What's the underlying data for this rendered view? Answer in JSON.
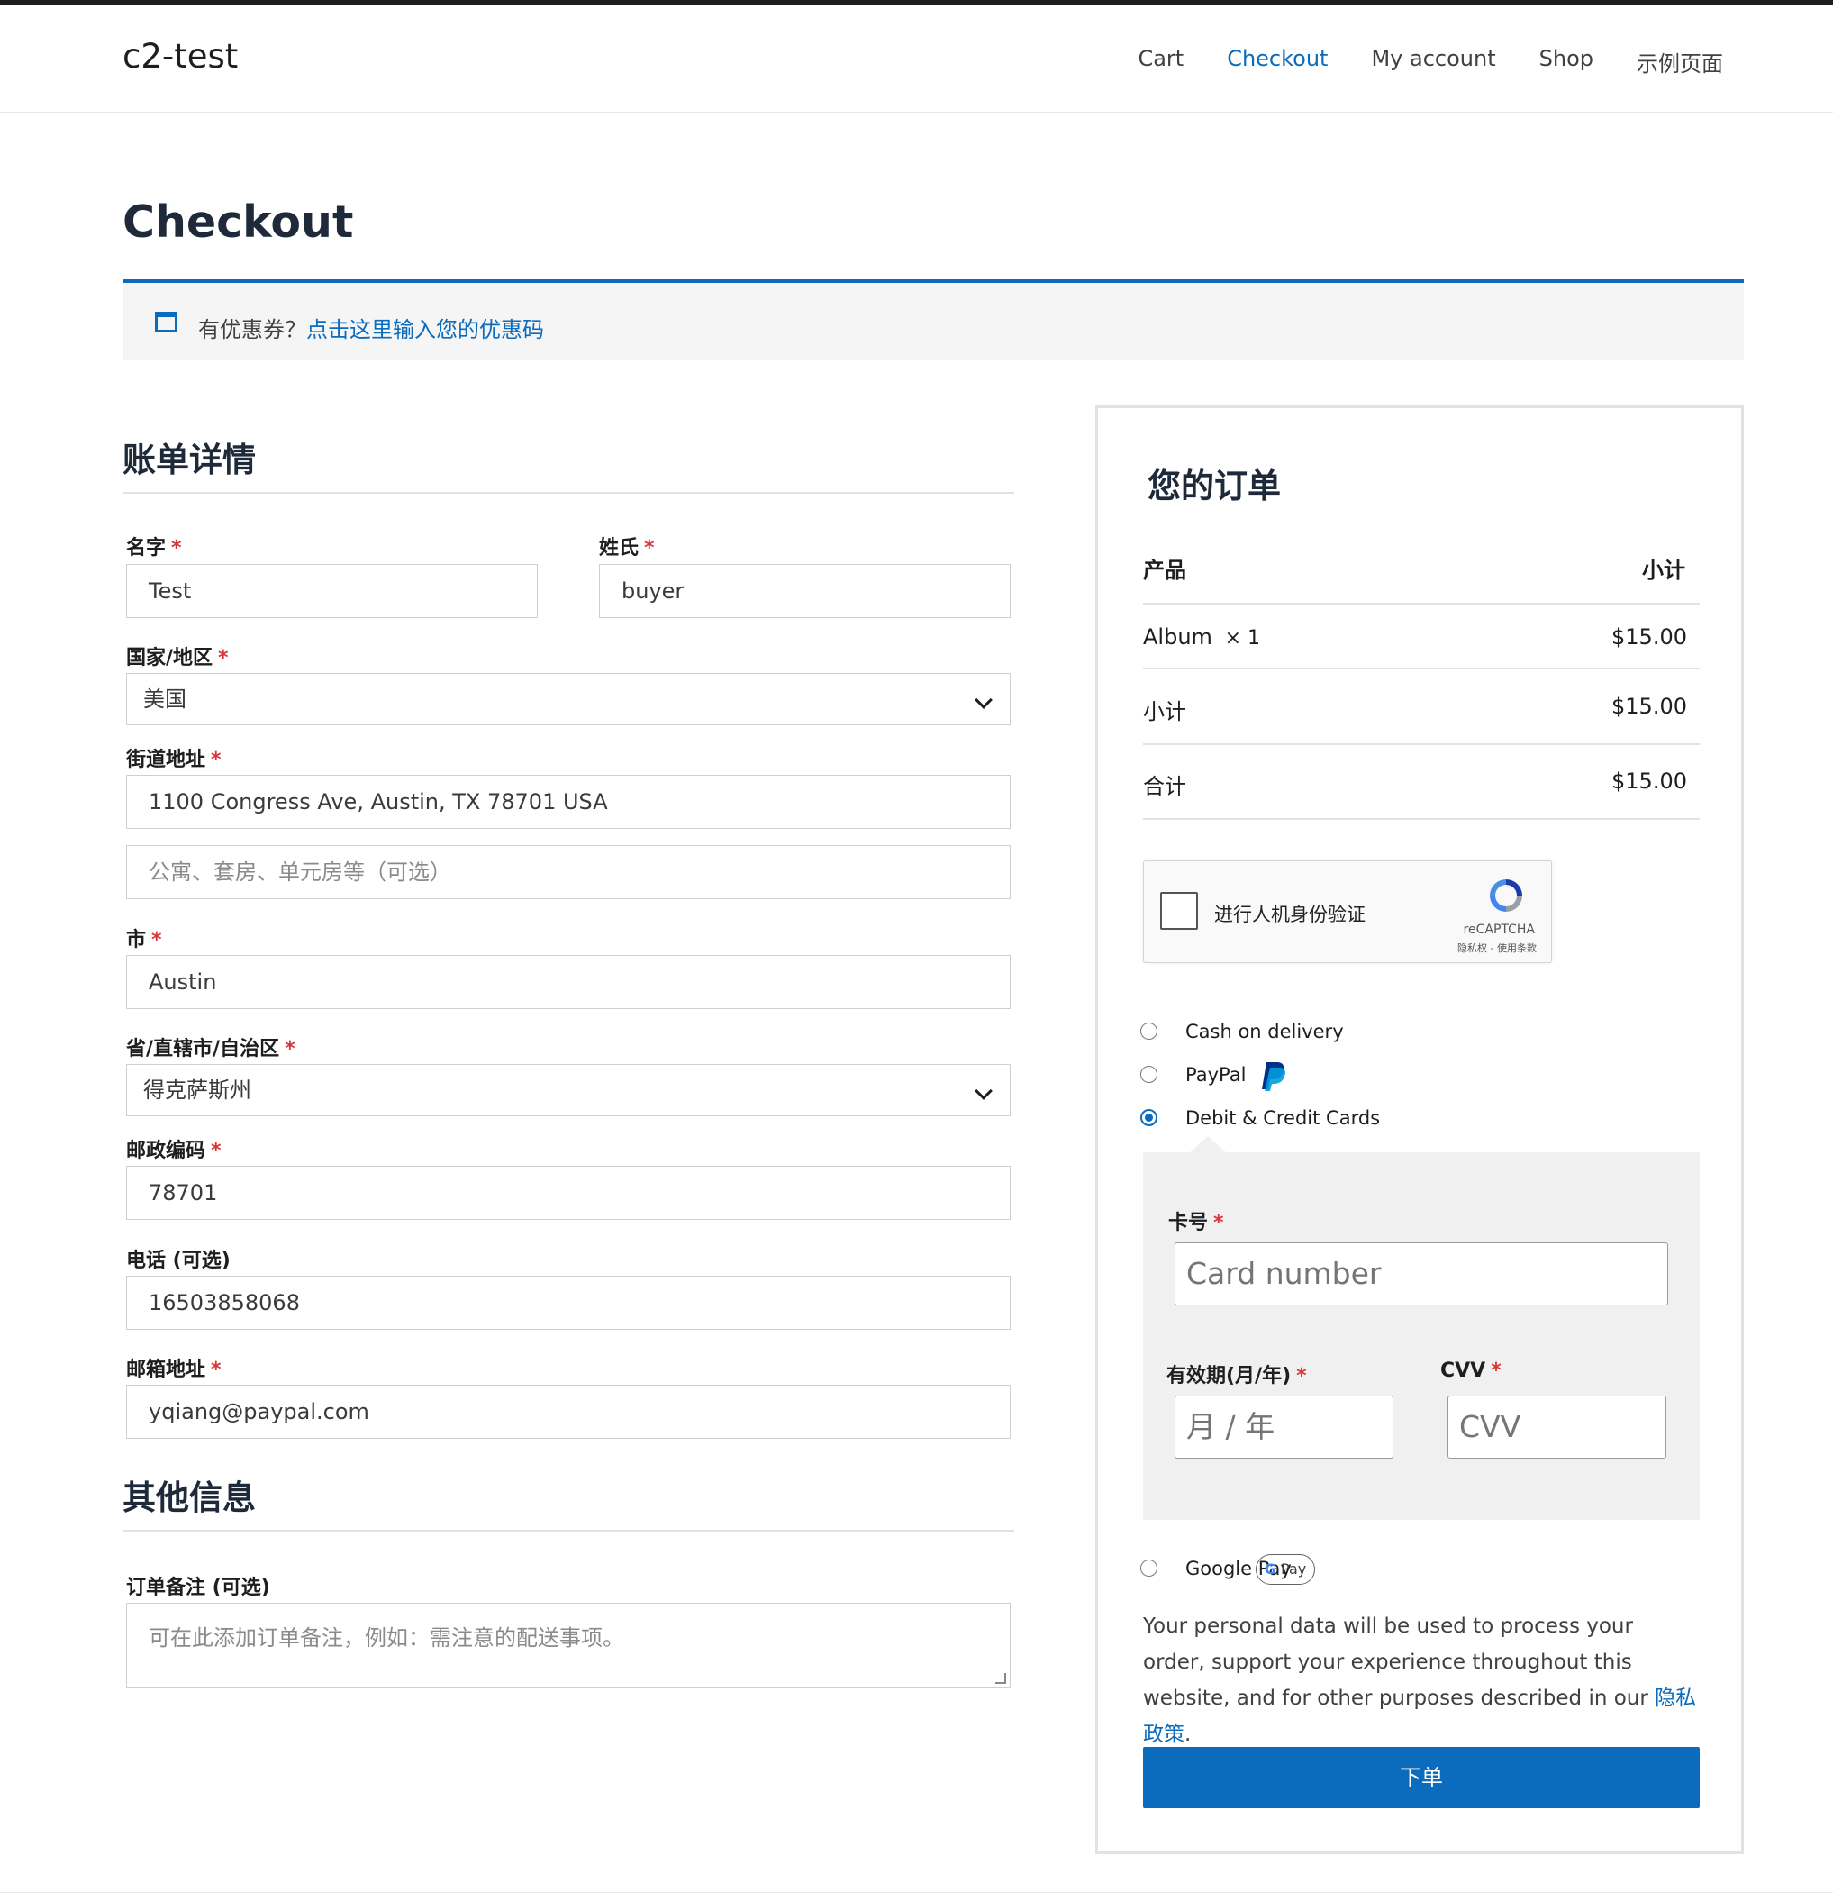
{
  "site": {
    "title": "c2-test"
  },
  "nav": {
    "items": [
      "Cart",
      "Checkout",
      "My account",
      "Shop",
      "示例页面"
    ],
    "active": "Checkout"
  },
  "page": {
    "title": "Checkout"
  },
  "coupon": {
    "prompt": "有优惠券？",
    "link": "点击这里输入您的优惠码"
  },
  "billing": {
    "title": "账单详情",
    "first_name": {
      "label": "名字",
      "value": "Test"
    },
    "last_name": {
      "label": "姓氏",
      "value": "buyer"
    },
    "country": {
      "label": "国家/地区",
      "value": "美国"
    },
    "street": {
      "label": "街道地址",
      "value": "1100 Congress Ave, Austin, TX 78701 USA",
      "placeholder2": "公寓、套房、单元房等（可选）"
    },
    "city": {
      "label": "市",
      "value": "Austin"
    },
    "state": {
      "label": "省/直辖市/自治区",
      "value": "得克萨斯州"
    },
    "postcode": {
      "label": "邮政编码",
      "value": "78701"
    },
    "phone": {
      "label": "电话 (可选)",
      "value": "16503858068"
    },
    "email": {
      "label": "邮箱地址",
      "value": "yqiang@paypal.com"
    },
    "required_mark": "*"
  },
  "additional": {
    "title": "其他信息",
    "notes": {
      "label": "订单备注 (可选)",
      "placeholder": "可在此添加订单备注，例如：需注意的配送事项。"
    }
  },
  "order": {
    "title": "您的订单",
    "col_product": "产品",
    "col_subtotal": "小计",
    "items": [
      {
        "name": "Album",
        "qty": "× 1",
        "price": "$15.00"
      }
    ],
    "subtotal_label": "小计",
    "subtotal_value": "$15.00",
    "total_label": "合计",
    "total_value": "$15.00"
  },
  "captcha": {
    "text": "进行人机身份验证",
    "brand": "reCAPTCHA",
    "terms": "隐私权 - 使用条款"
  },
  "payment": {
    "options": [
      "Cash on delivery",
      "PayPal",
      "Debit & Credit Cards",
      "Google Pay"
    ],
    "selected": "Debit & Credit Cards",
    "gpay_badge": "Pay",
    "gpay_badge_g": "G",
    "card": {
      "number_label": "卡号",
      "number_placeholder": "Card number",
      "expiry_label": "有效期(月/年)",
      "expiry_placeholder": "月 / 年",
      "cvv_label": "CVV",
      "cvv_placeholder": "CVV"
    }
  },
  "privacy": {
    "text": "Your personal data will be used to process your order, support your experience throughout this website, and for other purposes described in our ",
    "link": "隐私政策",
    "end": "."
  },
  "place_order": {
    "label": "下单"
  },
  "colors": {
    "accent": "#0b6bbd",
    "required": "#d63638",
    "paypal_dark": "#003087",
    "paypal_light": "#009cde"
  }
}
